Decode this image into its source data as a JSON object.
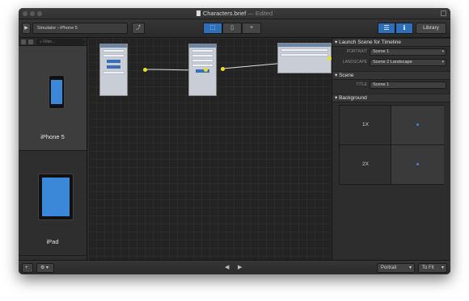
{
  "window": {
    "title": "Characters.brief",
    "title_suffix": "— Edited",
    "fullscreen_icon": "fullscreen-icon"
  },
  "toolbar": {
    "play_icon": "▶",
    "breadcrumb": [
      "Simulator",
      "iPhone 5"
    ],
    "breadcrumb_sep": "›",
    "share_icon": "⤴",
    "view_modes": [
      "⬚",
      "▯",
      "+"
    ],
    "active_view": 0,
    "inspector_icon": "☰",
    "info_icon": "ℹ",
    "library_label": "Library"
  },
  "left_panel": {
    "filter_placeholder": "Filter...",
    "devices": [
      {
        "label": "iPhone 5",
        "selected": true
      },
      {
        "label": "iPad",
        "selected": false
      }
    ]
  },
  "inspector": {
    "launch_section": {
      "title": "Launch Scene for Timeline",
      "portrait_label": "PORTRAIT",
      "portrait_value": "Scene 1",
      "landscape_label": "LANDSCAPE",
      "landscape_value": "Scene 2 Landscape"
    },
    "scene_section": {
      "title": "Scene",
      "title_label": "TITLE",
      "title_value": "Scene 1"
    },
    "background_section": {
      "title": "Background",
      "row_1x": "1X",
      "row_2x": "2X"
    }
  },
  "bottom": {
    "add_icon": "+",
    "gear_icon": "⚙",
    "prev": "◀",
    "next": "▶",
    "orientation": "Portrait",
    "zoom": "To Fit"
  },
  "colors": {
    "accent": "#2f6fba",
    "connector": "#e8e020",
    "window_bg": "#2b2b2b"
  }
}
